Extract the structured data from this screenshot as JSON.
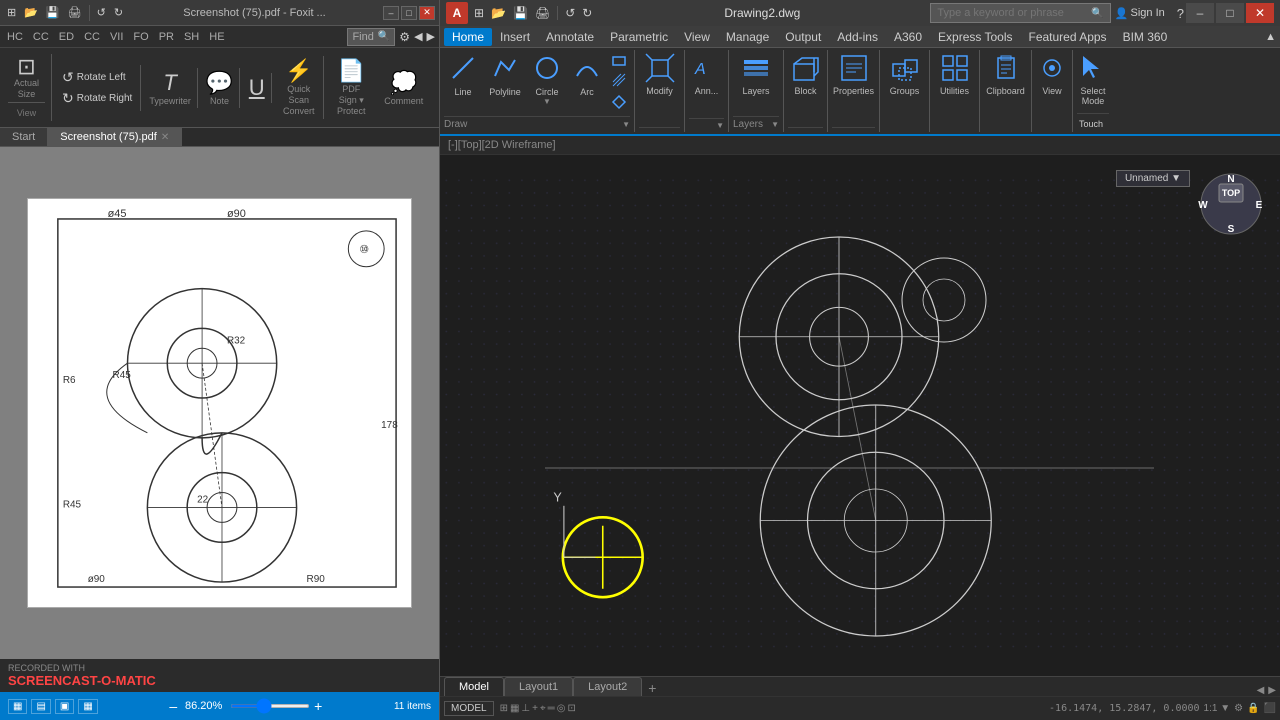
{
  "leftApp": {
    "title": "Screenshot (75).pdf - Foxit ...",
    "tabs": [
      {
        "label": "Start",
        "active": false,
        "closable": false
      },
      {
        "label": "Screenshot (75).pdf",
        "active": true,
        "closable": true
      }
    ],
    "toolbar": {
      "buttons": [
        "⊞",
        "◱",
        "⊡",
        "⤢",
        "←",
        "→",
        "⊟",
        "⊕",
        "86.20%",
        "⊖"
      ]
    },
    "zoom": "86.20%",
    "viewBtns": [
      "▦",
      "▤",
      "▣",
      "▦"
    ],
    "itemCount": "11 items",
    "leftTools": [
      {
        "label": "HC"
      },
      {
        "label": "CC"
      },
      {
        "label": "ED"
      },
      {
        "label": "CC"
      },
      {
        "label": "VII"
      },
      {
        "label": "FO"
      },
      {
        "label": "PR"
      },
      {
        "label": "SH"
      },
      {
        "label": "HE"
      }
    ],
    "ribbonLeft": [
      {
        "label": "Actual Size",
        "icon": "⊡"
      },
      {
        "label": "View",
        "icon": "👁"
      },
      {
        "label": "Rotate Left",
        "icon": "↺"
      },
      {
        "label": "Rotate Right",
        "icon": "↻"
      },
      {
        "label": "Typewriter",
        "icon": "T"
      },
      {
        "label": "Note",
        "icon": "📝"
      },
      {
        "label": "U",
        "icon": "U"
      },
      {
        "label": "Quick Scan Convert",
        "icon": "⚡"
      },
      {
        "label": "PDF Sign Protect",
        "icon": "📄"
      }
    ]
  },
  "acad": {
    "title": "Drawing2.dwg",
    "searchPlaceholder": "Type a keyword or phrase",
    "signIn": "Sign In",
    "menuItems": [
      "Home",
      "Insert",
      "Annotate",
      "Parametric",
      "View",
      "Manage",
      "Output",
      "Add-ins",
      "A360",
      "Express Tools",
      "Featured Apps",
      "BIM 360"
    ],
    "ribbonGroups": [
      {
        "label": "Draw",
        "buttons": [
          {
            "label": "Line",
            "icon": "line"
          },
          {
            "label": "Polyline",
            "icon": "polyline"
          },
          {
            "label": "Circle",
            "icon": "circle"
          },
          {
            "label": "Arc",
            "icon": "arc"
          },
          {
            "label": "Modify",
            "icon": "modify"
          },
          {
            "label": "Ann...",
            "icon": "ann"
          }
        ]
      },
      {
        "label": "Layers",
        "buttons": [
          {
            "label": "Layers",
            "icon": "layers"
          }
        ]
      },
      {
        "label": "",
        "buttons": [
          {
            "label": "Block",
            "icon": "block"
          }
        ]
      },
      {
        "label": "",
        "buttons": [
          {
            "label": "Properties",
            "icon": "properties"
          }
        ]
      },
      {
        "label": "",
        "buttons": [
          {
            "label": "Groups",
            "icon": "groups"
          }
        ]
      },
      {
        "label": "",
        "buttons": [
          {
            "label": "Utilities",
            "icon": "utilities"
          }
        ]
      },
      {
        "label": "",
        "buttons": [
          {
            "label": "Clipboard",
            "icon": "clipboard"
          }
        ]
      },
      {
        "label": "",
        "buttons": [
          {
            "label": "View",
            "icon": "view"
          }
        ]
      },
      {
        "label": "",
        "buttons": [
          {
            "label": "Select Mode",
            "icon": "select"
          }
        ]
      },
      {
        "label": "",
        "buttons": [
          {
            "label": "Touch",
            "icon": "touch"
          }
        ]
      }
    ],
    "viewport": {
      "header": "[-][Top][2D Wireframe]",
      "viewLabel": "Unnamed ▼"
    },
    "statusTabs": [
      "Model",
      "Layout1",
      "Layout2",
      "+"
    ],
    "activeTab": "Model",
    "coord": "-16.1474, 15.2847, 0.0000",
    "modelLabel": "MODEL"
  },
  "watermark": {
    "line1": "RECORDED WITH",
    "line2": "SCREENCAST-O-MATIC"
  }
}
